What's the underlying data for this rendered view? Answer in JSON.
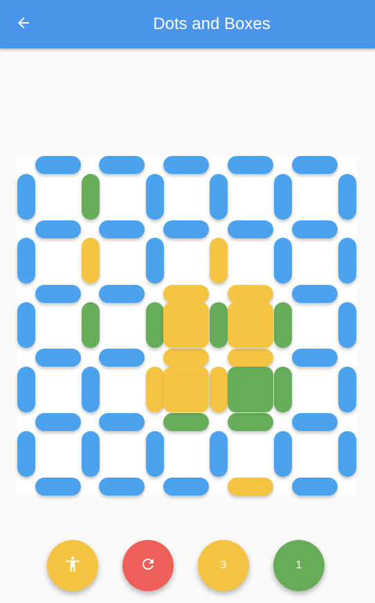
{
  "app": {
    "title": "Dots and Boxes"
  },
  "colors": {
    "appbar": "#4a95ea",
    "unplayed": "#4aa3ec",
    "player1": "#f6c443",
    "player2": "#67ac59",
    "reset": "#ef5f5a"
  },
  "icons": {
    "back": "arrow-left-icon",
    "accessibility": "accessibility-icon",
    "reset": "refresh-icon"
  },
  "grid": {
    "rows": 5,
    "cols": 5
  },
  "board": {
    "horizontal": [
      [
        "u",
        "u",
        "u",
        "u",
        "u"
      ],
      [
        "u",
        "u",
        "u",
        "u",
        "u"
      ],
      [
        "u",
        "u",
        "y",
        "y",
        "u"
      ],
      [
        "u",
        "u",
        "y",
        "y",
        "u"
      ],
      [
        "u",
        "u",
        "g",
        "g",
        "u"
      ],
      [
        "u",
        "u",
        "u",
        "y",
        "u"
      ]
    ],
    "vertical": [
      [
        "u",
        "g",
        "u",
        "u",
        "u",
        "u"
      ],
      [
        "u",
        "y",
        "u",
        "y",
        "u",
        "u"
      ],
      [
        "u",
        "g",
        "g",
        "g",
        "g",
        "u"
      ],
      [
        "u",
        "u",
        "y",
        "y",
        "g",
        "u"
      ],
      [
        "u",
        "u",
        "u",
        "u",
        "u",
        "u"
      ]
    ],
    "boxes": [
      [
        ".",
        ".",
        ".",
        ".",
        "."
      ],
      [
        ".",
        ".",
        ".",
        ".",
        "."
      ],
      [
        ".",
        ".",
        "y",
        "y",
        "."
      ],
      [
        ".",
        ".",
        "y",
        "g",
        "."
      ],
      [
        ".",
        ".",
        ".",
        ".",
        "."
      ]
    ]
  },
  "controls": {
    "player1_score": "3",
    "player2_score": "1"
  }
}
